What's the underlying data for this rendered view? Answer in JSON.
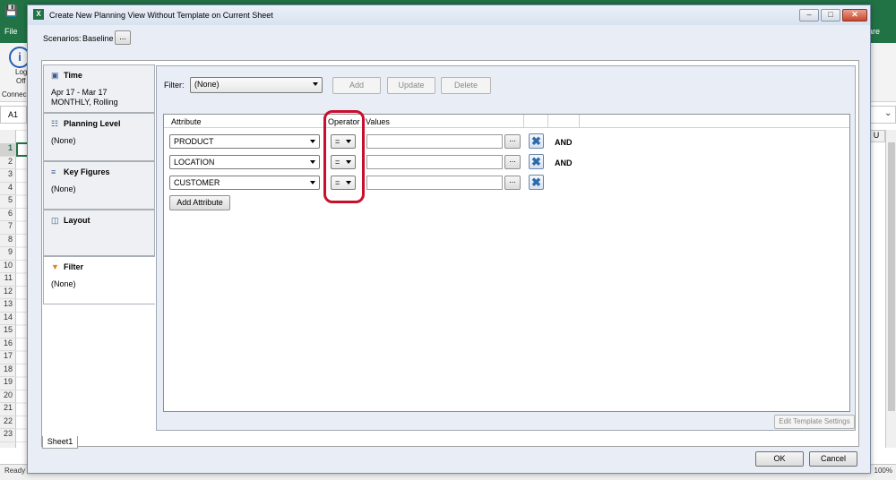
{
  "excel": {
    "save_icon": "save-icon",
    "file_tab": "File",
    "share_tab": "hare",
    "logoff_label_1": "Log",
    "logoff_label_2": "Off",
    "connect_label": "Connec",
    "name_box": "A1",
    "column_header": "U",
    "row_numbers": [
      "1",
      "2",
      "3",
      "4",
      "5",
      "6",
      "7",
      "8",
      "9",
      "10",
      "11",
      "12",
      "13",
      "14",
      "15",
      "16",
      "17",
      "18",
      "19",
      "20",
      "21",
      "22",
      "23"
    ],
    "status": "Ready",
    "zoom": "100%"
  },
  "dialog": {
    "title": "Create New Planning View Without Template on Current Sheet",
    "window_buttons": {
      "minimize": "–",
      "maximize": "□",
      "close": "✕"
    },
    "scenarios_label": "Scenarios:",
    "scenarios_value": "Baseline",
    "scenarios_button": "...",
    "nav": [
      {
        "title": "Time",
        "icon": "clock-icon",
        "lines": [
          "Apr 17 - Mar 17",
          "MONTHLY, Rolling"
        ]
      },
      {
        "title": "Planning Level",
        "icon": "hierarchy-icon",
        "lines": [
          "(None)"
        ]
      },
      {
        "title": "Key Figures",
        "icon": "list-icon",
        "lines": [
          "(None)"
        ]
      },
      {
        "title": "Layout",
        "icon": "layout-icon",
        "lines": []
      },
      {
        "title": "Filter",
        "icon": "funnel-icon",
        "lines": [
          "(None)"
        ]
      }
    ],
    "sheet_tab": "Sheet1",
    "filter": {
      "label": "Filter:",
      "selected": "(None)",
      "add_label": "Add",
      "update_label": "Update",
      "delete_label": "Delete"
    },
    "table": {
      "headers": [
        "Attribute",
        "Operator",
        "Values"
      ],
      "rows": [
        {
          "attribute": "PRODUCT",
          "operator": "=",
          "values": "",
          "value_button": "...",
          "connector": "AND"
        },
        {
          "attribute": "LOCATION",
          "operator": "=",
          "values": "",
          "value_button": "...",
          "connector": "AND"
        },
        {
          "attribute": "CUSTOMER",
          "operator": "=",
          "values": "",
          "value_button": "...",
          "connector": ""
        }
      ],
      "add_attribute_label": "Add Attribute",
      "delete_icon": "✖"
    },
    "edit_template_label": "Edit Template Settings",
    "ok_label": "OK",
    "cancel_label": "Cancel"
  },
  "colors": {
    "excel_green": "#217346",
    "highlight_red": "#c8102e",
    "dialog_bg": "#e9eef6"
  }
}
